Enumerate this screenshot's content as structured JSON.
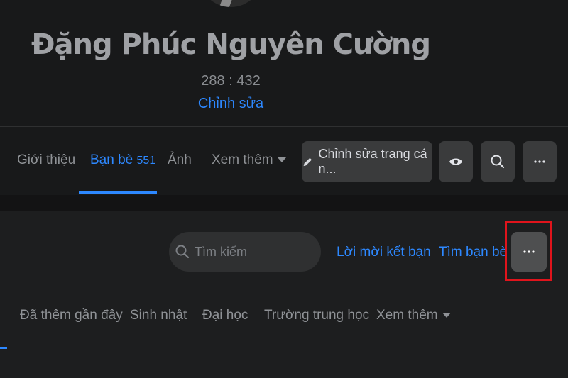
{
  "profile": {
    "name": "Đặng Phúc Nguyên Cường",
    "stats": "288 : 432",
    "edit_label": "Chỉnh sửa"
  },
  "tabs": {
    "intro": "Giới thiệu",
    "friends": "Bạn bè",
    "friends_count": "551",
    "photos": "Ảnh",
    "more": "Xem thêm",
    "edit_profile": "Chỉnh sửa trang cá n..."
  },
  "friends_section": {
    "search_placeholder": "Tìm kiếm",
    "friend_requests": "Lời mời kết bạn",
    "find_friends": "Tìm bạn bè",
    "subtabs": {
      "recently_added": "Đã thêm gần đây",
      "birthdays": "Sinh nhật",
      "university": "Đại học",
      "high_school": "Trường trung học",
      "more": "Xem thêm"
    }
  },
  "colors": {
    "background": "#18191a",
    "accent": "#2d88ff",
    "highlight": "#e0141c"
  }
}
